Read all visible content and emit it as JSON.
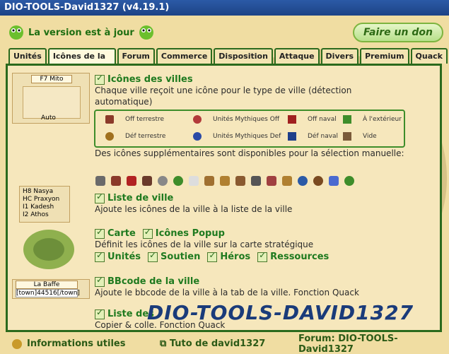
{
  "window": {
    "title": "DIO-TOOLS-David1327 (v4.19.1)"
  },
  "status": {
    "label": "La version est à jour"
  },
  "buttons": {
    "donate": "Faire un don"
  },
  "tabs": [
    "Unités",
    "Icônes de la ville",
    "Forum",
    "Commerce",
    "Disposition",
    "Attaque",
    "Divers",
    "Premium",
    "Quack"
  ],
  "sections": {
    "city_icons": {
      "title": "Icônes des villes",
      "desc": "Chaque ville reçoit une icône pour le type de ville (détection automatique)",
      "legend": [
        {
          "label": "Off terrestre",
          "icon": "sword-icon"
        },
        {
          "label": "Unités Mythiques Off",
          "icon": "mythic-off-icon"
        },
        {
          "label": "Off naval",
          "icon": "ship-off-icon"
        },
        {
          "label": "À l'extérieur",
          "icon": "double-chevron-icon"
        },
        {
          "label": "Déf terrestre",
          "icon": "shield-icon"
        },
        {
          "label": "Unités Mythiques Def",
          "icon": "mythic-def-icon"
        },
        {
          "label": "Déf naval",
          "icon": "ship-def-icon"
        },
        {
          "label": "Vide",
          "icon": "empty-icon"
        }
      ],
      "extra_desc": "Des icônes supplémentaires sont disponibles pour la sélection manuelle:"
    },
    "city_list": {
      "title": "Liste de ville",
      "desc": "Ajoute les icônes de la ville à la liste de la ville"
    },
    "map": {
      "title_card": "Carte",
      "title_popup": "Icônes Popup",
      "desc": "Définit les icônes de la ville sur la carte stratégique",
      "opts": [
        "Unités",
        "Soutien",
        "Héros",
        "Ressources"
      ]
    },
    "bbcode": {
      "title": "BBcode de la ville",
      "desc": "Ajoute le bbcode de la ville à la tab de la ville. Fonction Quack"
    },
    "list_bb": {
      "title": "Liste des",
      "desc": "Copier & colle. Fonction Quack"
    }
  },
  "thumbs": {
    "top_label": "F7 Mito",
    "top_btn": "Auto",
    "cities": [
      "H8 Nasya",
      "HC Praxyon",
      "I1 Kadesh",
      "I2 Athos"
    ],
    "bbcode_box": "La Baffe",
    "bbcode_input": "[town]44516[/town]"
  },
  "footer": {
    "info": "Informations utiles",
    "tuto": "Tuto de david1327",
    "forum": "Forum: DIO-TOOLS-David1327"
  },
  "overlay": {
    "watermark": "DIO-TOOLS-DAVID1327"
  },
  "colors": {
    "accent": "#2b6a1d",
    "title": "#1f7a1f",
    "bg": "#f0dda2"
  }
}
